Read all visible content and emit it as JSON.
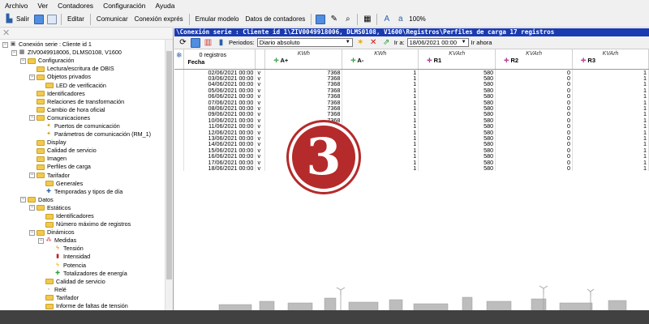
{
  "menu": [
    "Archivo",
    "Ver",
    "Contadores",
    "Configuración",
    "Ayuda"
  ],
  "toolbar": {
    "exit_label": "Salir",
    "edit_label": "Editar",
    "communicate_label": "Comunicar",
    "express_label": "Conexión exprés",
    "emulate_label": "Emular modelo",
    "meter_data_label": "Datos de contadores",
    "zoom": "100%"
  },
  "tree": [
    {
      "depth": 0,
      "label": "Conexión serie : Cliente id 1",
      "exp": "-",
      "icon": "connection-icon"
    },
    {
      "depth": 1,
      "label": "ZIV0049918006, DLMS0108, V1600",
      "exp": "-",
      "icon": "meter-icon"
    },
    {
      "depth": 2,
      "label": "Configuración",
      "exp": "-",
      "icon": "folder-icon"
    },
    {
      "depth": 3,
      "label": "Lectura/escritura de OBIS",
      "exp": "",
      "icon": "folder-icon"
    },
    {
      "depth": 3,
      "label": "Objetos privados",
      "exp": "-",
      "icon": "folder-icon"
    },
    {
      "depth": 4,
      "label": "LED de verificación",
      "exp": "",
      "icon": "folder-icon"
    },
    {
      "depth": 3,
      "label": "Identificadores",
      "exp": "",
      "icon": "folder-icon"
    },
    {
      "depth": 3,
      "label": "Relaciones de transformación",
      "exp": "",
      "icon": "folder-icon"
    },
    {
      "depth": 3,
      "label": "Cambio de hora oficial",
      "exp": "",
      "icon": "folder-icon"
    },
    {
      "depth": 3,
      "label": "Comunicaciones",
      "exp": "-",
      "icon": "folder-icon"
    },
    {
      "depth": 4,
      "label": "Puertos de comunicación",
      "exp": "",
      "icon": "port-icon"
    },
    {
      "depth": 4,
      "label": "Parámetros de comunicación (RM_1)",
      "exp": "",
      "icon": "port-icon"
    },
    {
      "depth": 3,
      "label": "Display",
      "exp": "",
      "icon": "folder-icon"
    },
    {
      "depth": 3,
      "label": "Calidad de servicio",
      "exp": "",
      "icon": "folder-icon"
    },
    {
      "depth": 3,
      "label": "Imagen",
      "exp": "",
      "icon": "folder-icon"
    },
    {
      "depth": 3,
      "label": "Perfiles de carga",
      "exp": "",
      "icon": "folder-icon"
    },
    {
      "depth": 3,
      "label": "Tarifador",
      "exp": "-",
      "icon": "folder-icon"
    },
    {
      "depth": 4,
      "label": "Generales",
      "exp": "",
      "icon": "folder-icon"
    },
    {
      "depth": 4,
      "label": "Temporadas y tipos de día",
      "exp": "",
      "icon": "calendar-icon"
    },
    {
      "depth": 2,
      "label": "Datos",
      "exp": "-",
      "icon": "folder-icon"
    },
    {
      "depth": 3,
      "label": "Estáticos",
      "exp": "-",
      "icon": "folder-icon"
    },
    {
      "depth": 4,
      "label": "Identificadores",
      "exp": "",
      "icon": "folder-icon"
    },
    {
      "depth": 4,
      "label": "Número máximo de registros",
      "exp": "",
      "icon": "folder-icon"
    },
    {
      "depth": 3,
      "label": "Dinámicos",
      "exp": "-",
      "icon": "folder-icon"
    },
    {
      "depth": 4,
      "label": "Medidas",
      "exp": "-",
      "icon": "measure-icon"
    },
    {
      "depth": 5,
      "label": "Tensión",
      "exp": "",
      "icon": "voltage-icon"
    },
    {
      "depth": 5,
      "label": "Intensidad",
      "exp": "",
      "icon": "current-icon"
    },
    {
      "depth": 5,
      "label": "Potencia",
      "exp": "",
      "icon": "power-icon"
    },
    {
      "depth": 5,
      "label": "Totalizadores de energía",
      "exp": "",
      "icon": "energy-icon"
    },
    {
      "depth": 4,
      "label": "Calidad de servicio",
      "exp": "",
      "icon": "folder-icon"
    },
    {
      "depth": 4,
      "label": "Relé",
      "exp": "",
      "icon": "relay-icon"
    },
    {
      "depth": 4,
      "label": "Tarifador",
      "exp": "",
      "icon": "folder-icon"
    },
    {
      "depth": 4,
      "label": "Informe de faltas de tensión",
      "exp": "",
      "icon": "folder-icon"
    }
  ],
  "window_title": "\\Conexión serie : Cliente id 1\\ZIV0049918006, DLMS0108, V1600\\Registros\\Perfiles de carga 17 registros",
  "period": {
    "label": "Periodos:",
    "value": "Diario absoluto",
    "goto_label": "Ir a:",
    "date_value": "18/06/2021 00:00",
    "now_label": "Ir ahora"
  },
  "grid": {
    "record_count": "0 registros",
    "date_header": "Fecha",
    "columns": [
      {
        "unit": "KWh",
        "name": "A+",
        "color": "#2a9d3a"
      },
      {
        "unit": "KWh",
        "name": "A-",
        "color": "#2a9d3a"
      },
      {
        "unit": "KVArh",
        "name": "R1",
        "color": "#b0208a"
      },
      {
        "unit": "KVArh",
        "name": "R2",
        "color": "#b0208a"
      },
      {
        "unit": "KVArh",
        "name": "R3",
        "color": "#b0208a"
      }
    ],
    "rows": [
      {
        "date": "02/06/2021 00:00",
        "flag": "v",
        "v": [
          "7368",
          "1",
          "580",
          "0",
          "1"
        ]
      },
      {
        "date": "03/06/2021 00:00",
        "flag": "v",
        "v": [
          "7368",
          "1",
          "580",
          "0",
          "1"
        ]
      },
      {
        "date": "04/06/2021 00:00",
        "flag": "v",
        "v": [
          "7368",
          "1",
          "580",
          "0",
          "1"
        ]
      },
      {
        "date": "05/06/2021 00:00",
        "flag": "v",
        "v": [
          "7368",
          "1",
          "580",
          "0",
          "1"
        ]
      },
      {
        "date": "06/06/2021 00:00",
        "flag": "v",
        "v": [
          "7368",
          "1",
          "580",
          "0",
          "1"
        ]
      },
      {
        "date": "07/06/2021 00:00",
        "flag": "v",
        "v": [
          "7368",
          "1",
          "580",
          "0",
          "1"
        ]
      },
      {
        "date": "08/06/2021 00:00",
        "flag": "v",
        "v": [
          "7368",
          "1",
          "580",
          "0",
          "1"
        ]
      },
      {
        "date": "09/06/2021 00:00",
        "flag": "v",
        "v": [
          "7368",
          "1",
          "580",
          "0",
          "1"
        ]
      },
      {
        "date": "10/06/2021 00:00",
        "flag": "v",
        "v": [
          "7368",
          "1",
          "580",
          "0",
          "1"
        ]
      },
      {
        "date": "11/06/2021 00:00",
        "flag": "v",
        "v": [
          "7368",
          "1",
          "580",
          "0",
          "1"
        ]
      },
      {
        "date": "12/06/2021 00:00",
        "flag": "v",
        "v": [
          "7368",
          "1",
          "580",
          "0",
          "1"
        ]
      },
      {
        "date": "13/06/2021 00:00",
        "flag": "v",
        "v": [
          "7368",
          "1",
          "580",
          "0",
          "1"
        ]
      },
      {
        "date": "14/06/2021 00:00",
        "flag": "v",
        "v": [
          "7368",
          "1",
          "580",
          "0",
          "1"
        ]
      },
      {
        "date": "15/06/2021 00:00",
        "flag": "v",
        "v": [
          "7368",
          "1",
          "580",
          "0",
          "1"
        ]
      },
      {
        "date": "16/06/2021 00:00",
        "flag": "v",
        "v": [
          "7368",
          "1",
          "580",
          "0",
          "1"
        ]
      },
      {
        "date": "17/06/2021 00:00",
        "flag": "v",
        "v": [
          "7368",
          "1",
          "580",
          "0",
          "1"
        ]
      },
      {
        "date": "18/06/2021 00:00",
        "flag": "v",
        "v": [
          "7368",
          "1",
          "580",
          "0",
          "1"
        ]
      }
    ]
  },
  "logo": {
    "numeral": "3",
    "color": "#b52a2a"
  }
}
